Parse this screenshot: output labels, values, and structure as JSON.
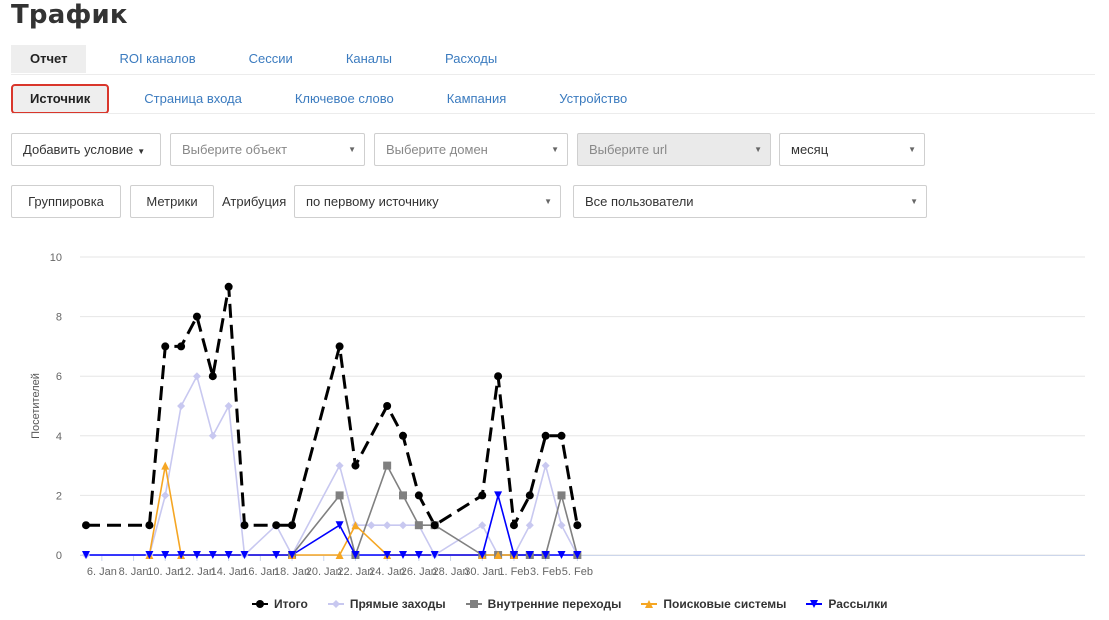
{
  "title": "Трафик",
  "tabs_top": [
    "Отчет",
    "ROI каналов",
    "Сессии",
    "Каналы",
    "Расходы"
  ],
  "tabs_sub": [
    "Источник",
    "Страница входа",
    "Ключевое слово",
    "Кампания",
    "Устройство"
  ],
  "filters": {
    "add_condition": "Добавить условие",
    "object_placeholder": "Выберите объект",
    "domain_placeholder": "Выберите домен",
    "url_placeholder": "Выберите url",
    "period": "месяц"
  },
  "controls": {
    "grouping": "Группировка",
    "metrics": "Метрики",
    "attribution_label": "Атрибуция",
    "attribution_value": "по первому источнику",
    "users": "Все пользователи"
  },
  "chart_data": {
    "type": "line",
    "ylabel": "Посетителей",
    "ylim": [
      0,
      10
    ],
    "yticks": [
      "0",
      "2",
      "4",
      "6",
      "8",
      "10"
    ],
    "xtick_labels": [
      "6. Jan",
      "8. Jan",
      "10. Jan",
      "12. Jan",
      "14. Jan",
      "16. Jan",
      "18. Jan",
      "20. Jan",
      "22. Jan",
      "24. Jan",
      "26. Jan",
      "28. Jan",
      "30. Jan",
      "1. Feb",
      "3. Feb",
      "5. Feb"
    ],
    "series": [
      {
        "name": "Итого",
        "color": "#000000",
        "dashed": true,
        "marker": "circle",
        "points": [
          [
            "5. Jan",
            1
          ],
          [
            "9. Jan",
            1
          ],
          [
            "10. Jan",
            7
          ],
          [
            "11. Jan",
            7
          ],
          [
            "12. Jan",
            8
          ],
          [
            "13. Jan",
            6
          ],
          [
            "14. Jan",
            9
          ],
          [
            "15. Jan",
            1
          ],
          [
            "17. Jan",
            1
          ],
          [
            "18. Jan",
            1
          ],
          [
            "21. Jan",
            7
          ],
          [
            "22. Jan",
            3
          ],
          [
            "24. Jan",
            5
          ],
          [
            "25. Jan",
            4
          ],
          [
            "26. Jan",
            2
          ],
          [
            "27. Jan",
            1
          ],
          [
            "30. Jan",
            2
          ],
          [
            "31. Jan",
            6
          ],
          [
            "1. Feb",
            1
          ],
          [
            "2. Feb",
            2
          ],
          [
            "3. Feb",
            4
          ],
          [
            "4. Feb",
            4
          ],
          [
            "5. Feb",
            1
          ]
        ]
      },
      {
        "name": "Прямые заходы",
        "color": "#c8c8f0",
        "dashed": false,
        "marker": "diamond",
        "points": [
          [
            "5. Jan",
            0
          ],
          [
            "9. Jan",
            0
          ],
          [
            "10. Jan",
            2
          ],
          [
            "11. Jan",
            5
          ],
          [
            "12. Jan",
            6
          ],
          [
            "13. Jan",
            4
          ],
          [
            "14. Jan",
            5
          ],
          [
            "15. Jan",
            0
          ],
          [
            "17. Jan",
            1
          ],
          [
            "18. Jan",
            0
          ],
          [
            "21. Jan",
            3
          ],
          [
            "22. Jan",
            1
          ],
          [
            "23. Jan",
            1
          ],
          [
            "24. Jan",
            1
          ],
          [
            "25. Jan",
            1
          ],
          [
            "26. Jan",
            1
          ],
          [
            "27. Jan",
            0
          ],
          [
            "30. Jan",
            1
          ],
          [
            "31. Jan",
            0
          ],
          [
            "1. Feb",
            0
          ],
          [
            "2. Feb",
            1
          ],
          [
            "3. Feb",
            3
          ],
          [
            "4. Feb",
            1
          ],
          [
            "5. Feb",
            0
          ]
        ]
      },
      {
        "name": "Внутренние переходы",
        "color": "#808080",
        "dashed": false,
        "marker": "square",
        "points": [
          [
            "18. Jan",
            0
          ],
          [
            "21. Jan",
            2
          ],
          [
            "22. Jan",
            0
          ],
          [
            "24. Jan",
            3
          ],
          [
            "25. Jan",
            2
          ],
          [
            "26. Jan",
            1
          ],
          [
            "27. Jan",
            1
          ],
          [
            "30. Jan",
            0
          ],
          [
            "31. Jan",
            0
          ],
          [
            "1. Feb",
            0
          ],
          [
            "2. Feb",
            0
          ],
          [
            "3. Feb",
            0
          ],
          [
            "4. Feb",
            2
          ],
          [
            "5. Feb",
            0
          ]
        ]
      },
      {
        "name": "Поисковые системы",
        "color": "#f5a623",
        "dashed": false,
        "marker": "triangle-up",
        "points": [
          [
            "9. Jan",
            0
          ],
          [
            "10. Jan",
            3
          ],
          [
            "11. Jan",
            0
          ],
          [
            "18. Jan",
            0
          ],
          [
            "21. Jan",
            0
          ],
          [
            "22. Jan",
            1
          ],
          [
            "24. Jan",
            0
          ],
          [
            "30. Jan",
            0
          ],
          [
            "31. Jan",
            0
          ],
          [
            "1. Feb",
            0
          ]
        ]
      },
      {
        "name": "Рассылки",
        "color": "#0000ff",
        "dashed": false,
        "marker": "triangle-down",
        "points": [
          [
            "5. Jan",
            0
          ],
          [
            "9. Jan",
            0
          ],
          [
            "10. Jan",
            0
          ],
          [
            "11. Jan",
            0
          ],
          [
            "12. Jan",
            0
          ],
          [
            "13. Jan",
            0
          ],
          [
            "14. Jan",
            0
          ],
          [
            "15. Jan",
            0
          ],
          [
            "17. Jan",
            0
          ],
          [
            "18. Jan",
            0
          ],
          [
            "21. Jan",
            1
          ],
          [
            "22. Jan",
            0
          ],
          [
            "24. Jan",
            0
          ],
          [
            "25. Jan",
            0
          ],
          [
            "26. Jan",
            0
          ],
          [
            "27. Jan",
            0
          ],
          [
            "30. Jan",
            0
          ],
          [
            "31. Jan",
            2
          ],
          [
            "1. Feb",
            0
          ],
          [
            "2. Feb",
            0
          ],
          [
            "3. Feb",
            0
          ],
          [
            "4. Feb",
            0
          ],
          [
            "5. Feb",
            0
          ]
        ]
      }
    ]
  }
}
